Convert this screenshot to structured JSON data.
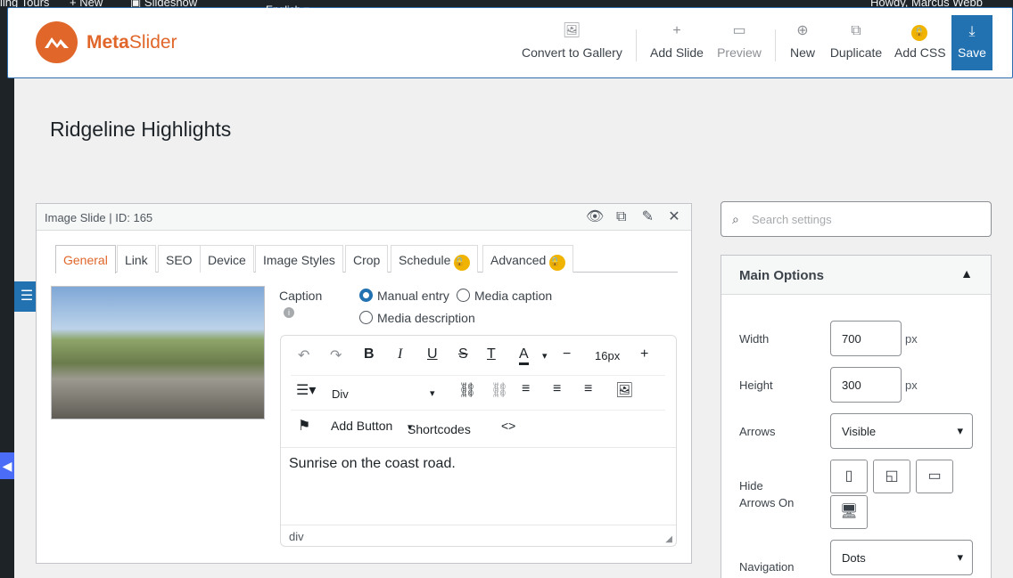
{
  "admin_bar": {
    "site": "ling Tours",
    "new": "+ New",
    "slideshow": "Slideshow",
    "howdy": "Howdy, Marcus Webb",
    "language": "English"
  },
  "brand": {
    "name_bold": "Meta",
    "name_rest": "Slider"
  },
  "toolbar": {
    "convert": "Convert to Gallery",
    "add_slide": "Add Slide",
    "preview": "Preview",
    "new": "New",
    "duplicate": "Duplicate",
    "add_css": "Add CSS",
    "save": "Save"
  },
  "page_title": "Ridgeline Highlights",
  "slide": {
    "header": "Image Slide | ID: 165",
    "tabs": [
      "General",
      "Link",
      "SEO",
      "Device",
      "Image Styles",
      "Crop",
      "Schedule",
      "Advanced"
    ],
    "active_tab": "General",
    "caption_label": "Caption",
    "caption_options": [
      "Manual entry",
      "Media caption",
      "Media description"
    ],
    "selected_caption_option": "Manual entry",
    "editor": {
      "block_format": "Div",
      "font_size": "16px",
      "add_button": "Add Button",
      "shortcodes": "Shortcodes",
      "content": "Sunrise on the coast road.",
      "path": "div"
    }
  },
  "search": {
    "placeholder": "Search settings"
  },
  "main_options": {
    "title": "Main Options",
    "width_label": "Width",
    "width_value": "700",
    "width_unit": "px",
    "height_label": "Height",
    "height_value": "300",
    "height_unit": "px",
    "arrows_label": "Arrows",
    "arrows_value": "Visible",
    "hide_arrows_label_1": "Hide",
    "hide_arrows_label_2": "Arrows On",
    "navigation_label": "Navigation",
    "navigation_value": "Dots"
  },
  "colors": {
    "brand": "#e0662a",
    "accent": "#2271b1",
    "lock": "#f0b400"
  }
}
